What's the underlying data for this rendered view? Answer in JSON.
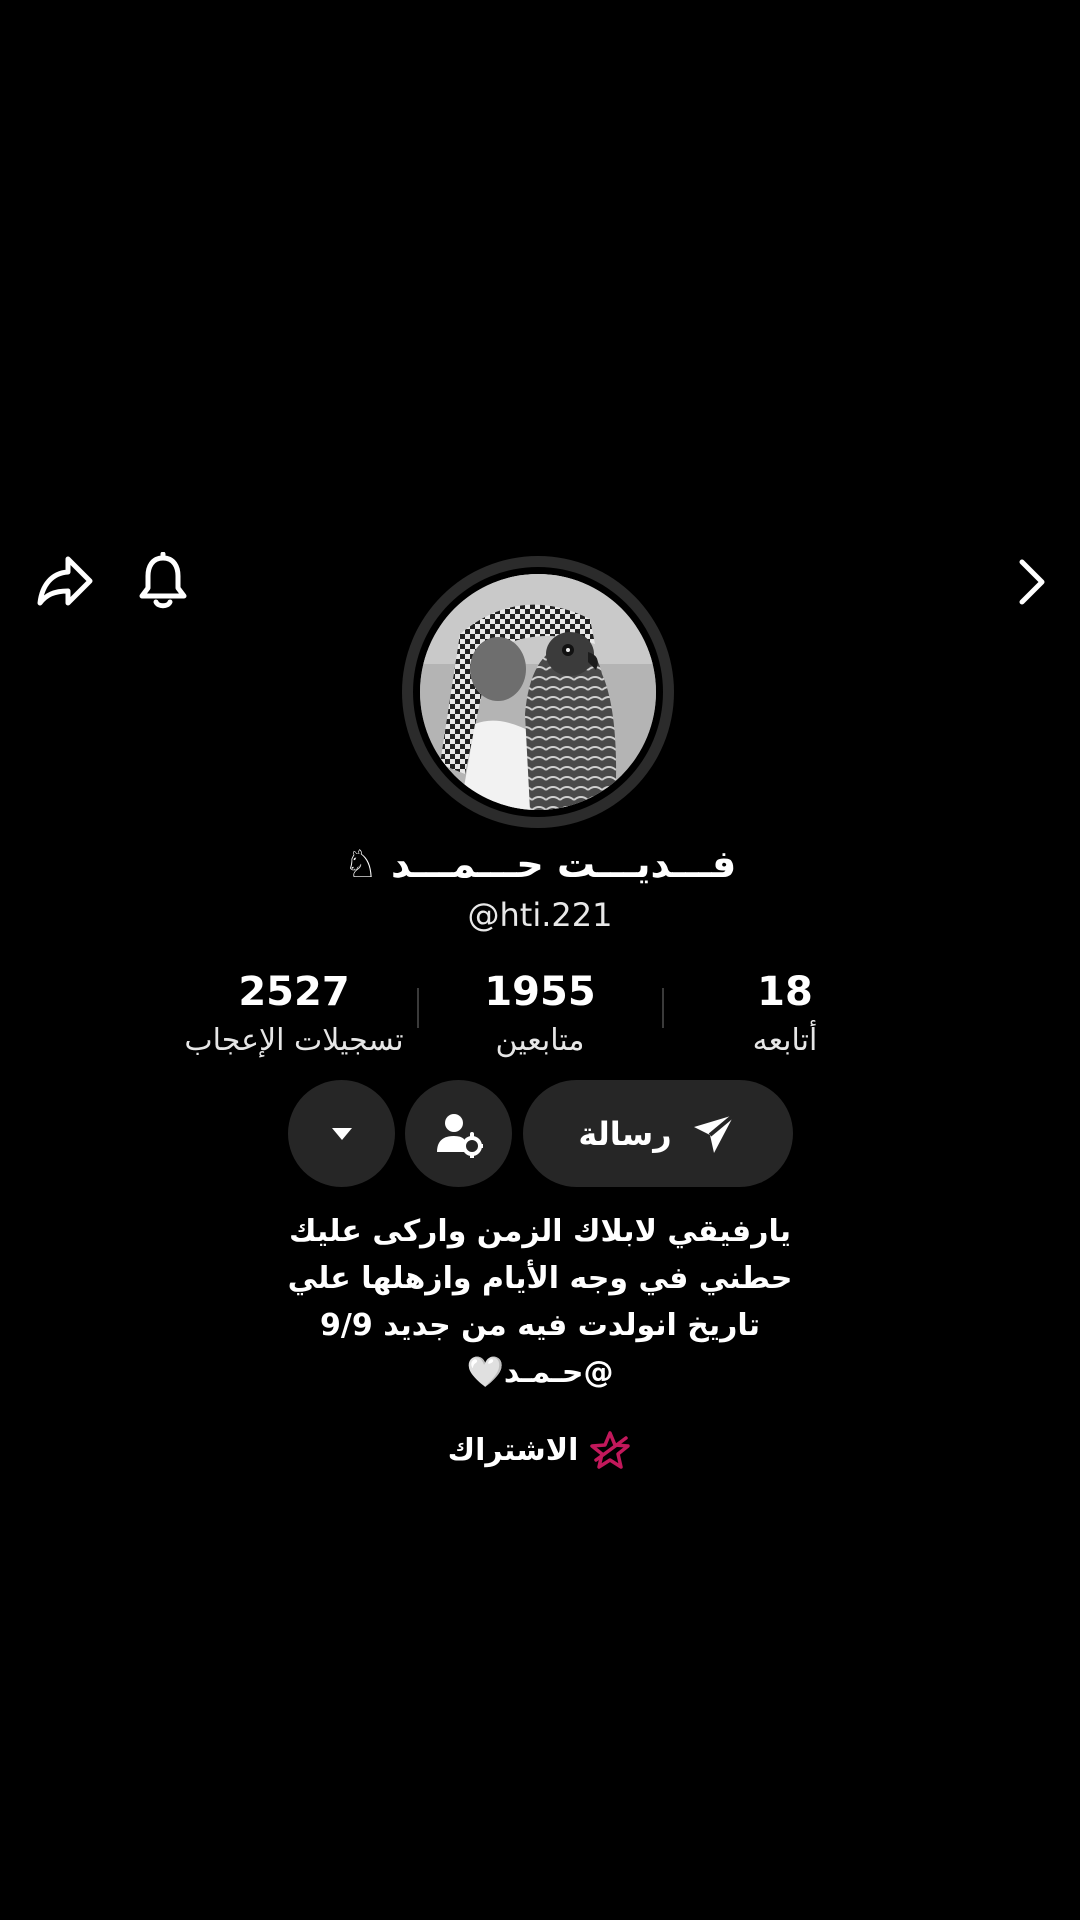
{
  "header": {
    "share_icon": "share-arrow-icon",
    "bell_icon": "bell-icon",
    "forward_icon": "chevron-right-icon"
  },
  "profile": {
    "display_name": "فـــديـــت حـــمـــد ♘",
    "handle": "@hti.221"
  },
  "stats": {
    "following_count": "18",
    "following_label": "أتابعه",
    "followers_count": "1955",
    "followers_label": "متابعين",
    "likes_count": "2527",
    "likes_label": "تسجيلات الإعجاب"
  },
  "actions": {
    "message_label": "رسالة",
    "message_icon": "send-icon",
    "profile_settings_icon": "user-gear-icon",
    "more_icon": "caret-down-icon"
  },
  "bio": {
    "line1": "يارفيقي لابلاك الزمن واركى عليك",
    "line2": "حطني في وجه الأيام وازهلها علي",
    "line3": "تاريخ انولدت فيه من جديد 9/9",
    "line4": "@حـمـد🤍"
  },
  "subscription": {
    "label": "الاشتراك",
    "icon": "star-badge-icon",
    "icon_color": "#c2185b"
  }
}
